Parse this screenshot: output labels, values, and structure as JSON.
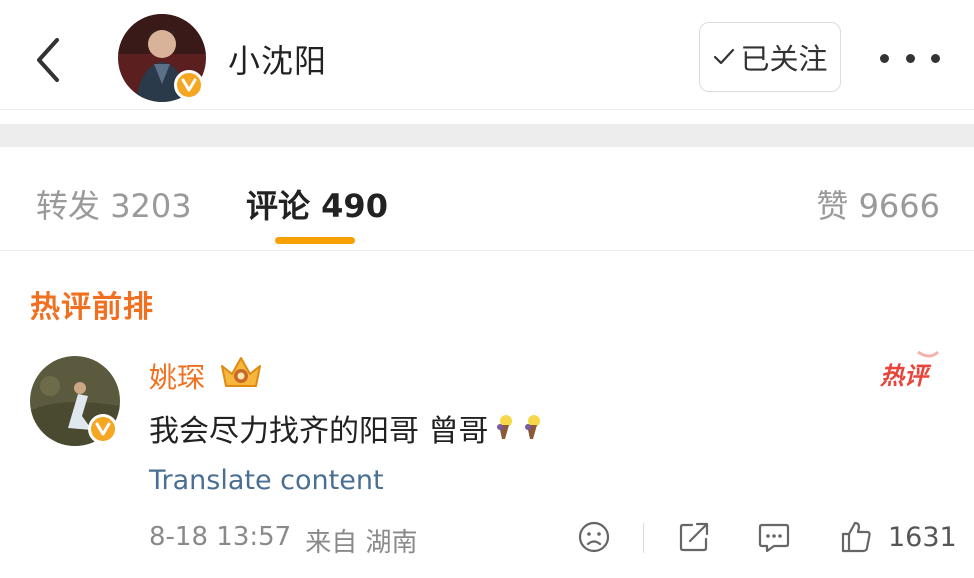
{
  "header": {
    "author_name": "小沈阳",
    "follow_label": "已关注"
  },
  "tabs": {
    "repost": {
      "label": "转发",
      "count": "3203"
    },
    "comments": {
      "label": "评论",
      "count": "490"
    },
    "likes": {
      "label": "赞",
      "count": "9666"
    }
  },
  "section": {
    "title": "热评前排"
  },
  "comment": {
    "author": "姚琛",
    "hot_stamp": "热评",
    "text": "我会尽力找齐的阳哥 曾哥",
    "emojis": [
      "bouquet-emoji",
      "bouquet-emoji"
    ],
    "translate_label": "Translate content",
    "date": "8-18 13:57",
    "source": "来自 湖南",
    "like_count": "1631"
  },
  "colors": {
    "accent_orange": "#f07020",
    "tab_underline": "#f8a000",
    "verified_badge": "#f5a623",
    "link_blue": "#4a6f93",
    "hot_red": "#e8443a"
  }
}
